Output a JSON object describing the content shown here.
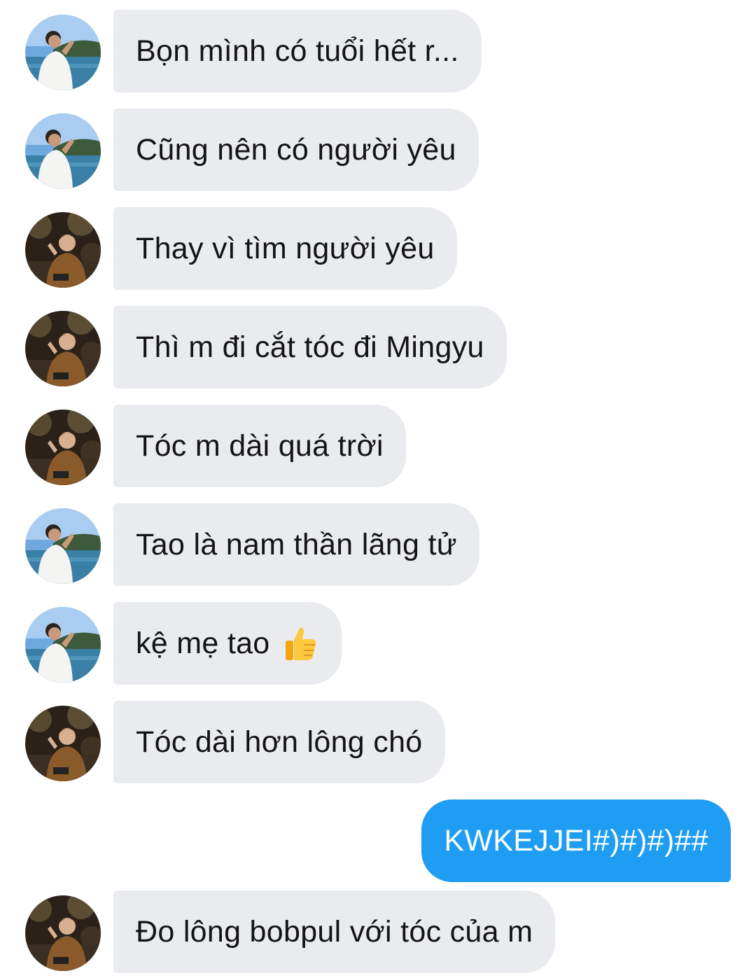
{
  "conversation": {
    "messages": [
      {
        "sender": "boy",
        "text": "Bọn mình có tuổi hết r..."
      },
      {
        "sender": "boy",
        "text": "Cũng nên có người yêu"
      },
      {
        "sender": "girl",
        "text": "Thay vì tìm người yêu"
      },
      {
        "sender": "girl",
        "text": "Thì m đi cắt tóc đi Mingyu"
      },
      {
        "sender": "girl",
        "text": "Tóc m dài quá trời"
      },
      {
        "sender": "boy",
        "text": "Tao là nam thần lãng tử"
      },
      {
        "sender": "boy",
        "text": "kệ mẹ tao",
        "emoji": "thumbs-up-icon"
      },
      {
        "sender": "girl",
        "text": "Tóc dài hơn lông chó"
      },
      {
        "sender": "me",
        "text": "KWKEJJEI#)#)#)##"
      },
      {
        "sender": "girl",
        "text": "Đo lông bobpul với tóc của m"
      }
    ]
  },
  "colors": {
    "incoming_bubble": "#e9ebee",
    "outgoing_bubble": "#1e9df2",
    "incoming_text": "#141414",
    "outgoing_text": "#ffffff"
  },
  "avatars": {
    "boy": "avatar-man-by-lake",
    "girl": "avatar-person-in-autumn-park"
  }
}
